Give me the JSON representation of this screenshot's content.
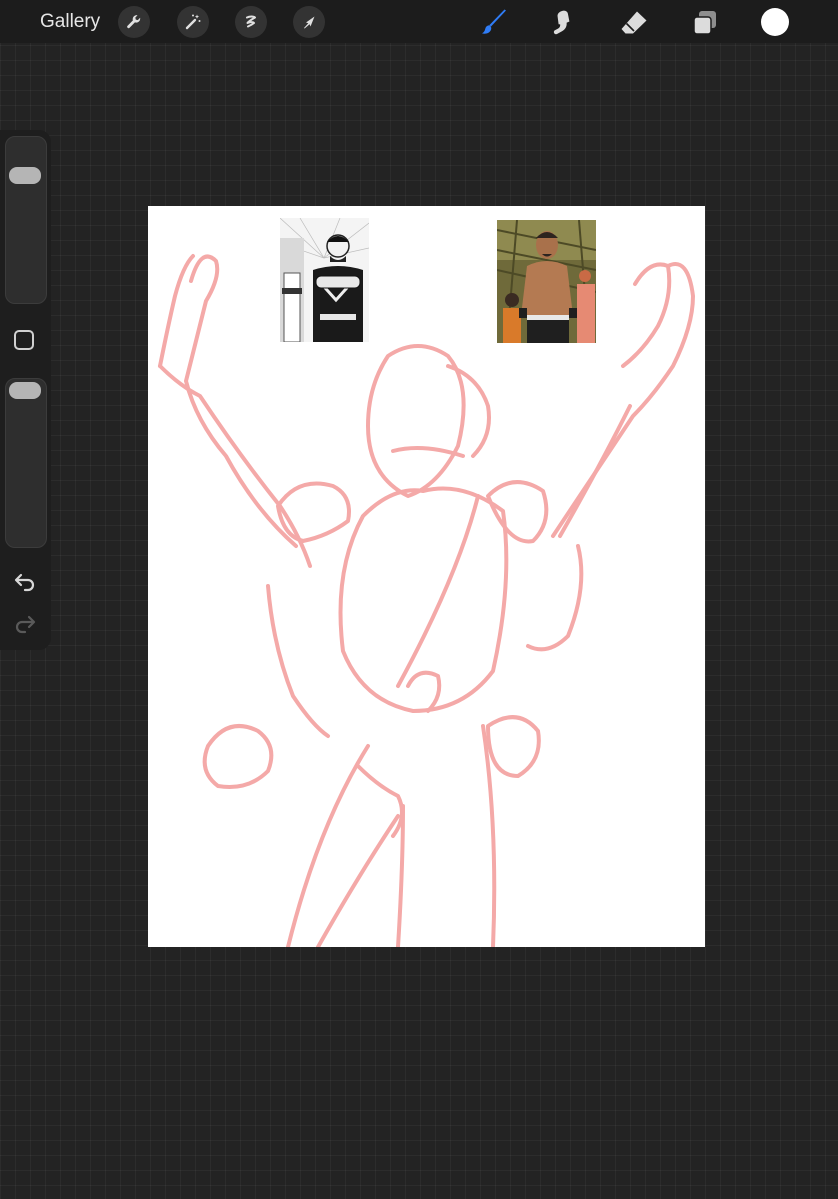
{
  "toolbar": {
    "gallery_label": "Gallery",
    "left_tools": [
      "wrench-icon",
      "magic-wand-icon",
      "selection-icon",
      "transform-arrow-icon"
    ],
    "right_tools": [
      "brush-icon",
      "smudge-icon",
      "eraser-icon",
      "layers-icon"
    ],
    "active_tool": "brush-icon",
    "accent_color": "#2f7cf6",
    "current_color": "#ffffff"
  },
  "sidebar": {
    "brush_size_level": 0.95,
    "opacity_level": 1.0,
    "buttons": [
      "modify-square-icon",
      "undo-icon",
      "redo-icon"
    ]
  },
  "canvas": {
    "background_color": "#ffffff",
    "sketch_color": "#f4a9a8",
    "reference_images": [
      "manga-reference-image",
      "anime-reference-image"
    ]
  }
}
